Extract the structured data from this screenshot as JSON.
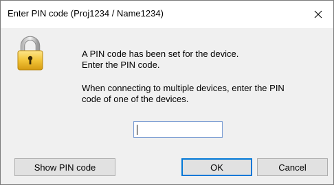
{
  "dialog": {
    "title": "Enter PIN code (Proj1234 / Name1234)",
    "close_icon": "close-icon"
  },
  "lock_icon": "padlock-icon",
  "message": {
    "line1": "A PIN code has been set for the device.",
    "line2": "Enter the PIN code.",
    "line3": "When connecting to multiple devices, enter the PIN",
    "line4": "code of one of the devices."
  },
  "pin_field": {
    "value": ""
  },
  "buttons": {
    "show_pin": "Show PIN code",
    "ok": "OK",
    "cancel": "Cancel"
  },
  "colors": {
    "accent": "#0078d7",
    "lock_body": "#f2c438"
  }
}
